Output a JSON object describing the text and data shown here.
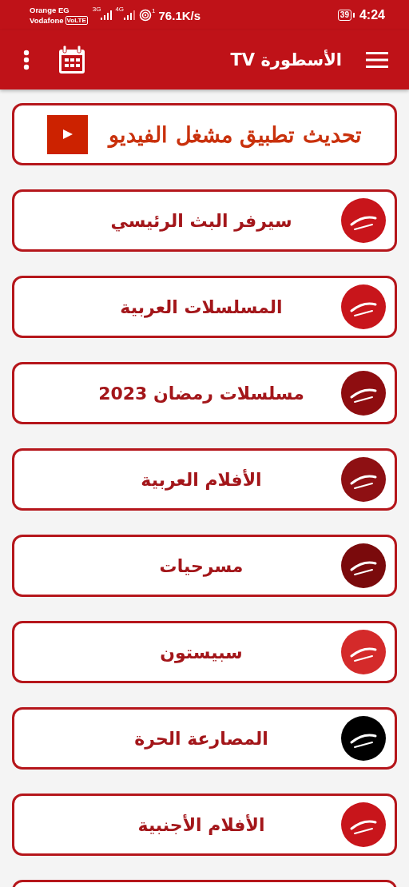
{
  "status_bar": {
    "carrier_1": "Orange EG",
    "carrier_2": "Vodafone",
    "volte": "VoLTE",
    "network_1": "3G",
    "network_2": "4G",
    "hotspot_count": "1",
    "speed": "76.1K/s",
    "battery": "39",
    "time": "4:24"
  },
  "header": {
    "title": "الأسطورة TV"
  },
  "update_banner": {
    "label": "تحديث تطبيق مشغل الفيديو"
  },
  "items": [
    {
      "kind": "menu",
      "label": "سيرفر البث الرئيسي",
      "color": "#c8151b"
    },
    {
      "kind": "menu",
      "label": "المسلسلات العربية",
      "color": "#c8151b"
    },
    {
      "kind": "menu",
      "label": "مسلسلات رمضان 2023",
      "color": "#8e0d10"
    },
    {
      "kind": "menu",
      "label": "الأفلام العربية",
      "color": "#8e1013"
    },
    {
      "kind": "menu",
      "label": "مسرحيات",
      "color": "#7a0a0c"
    },
    {
      "kind": "menu",
      "label": "سبيستون",
      "color": "#d42a2a"
    },
    {
      "kind": "menu",
      "label": "المصارعة الحرة",
      "color": "#000000"
    },
    {
      "kind": "menu",
      "label": "الأفلام الأجنبية",
      "color": "#c8151b"
    },
    {
      "kind": "cut"
    }
  ]
}
